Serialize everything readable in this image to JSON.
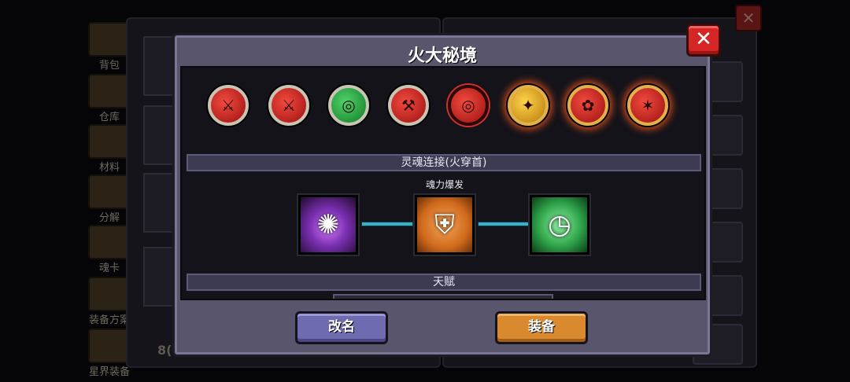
{
  "background": {
    "sidebar": [
      {
        "label": "背包",
        "icon": "backpack-icon"
      },
      {
        "label": "仓库",
        "icon": "chest-icon"
      },
      {
        "label": "材料",
        "icon": "materials-icon"
      },
      {
        "label": "分解",
        "icon": "decompose-icon"
      },
      {
        "label": "魂卡",
        "icon": "soul-card-icon"
      },
      {
        "label": "装备方案",
        "icon": "equipment-plan-icon"
      },
      {
        "label": "星界装备",
        "icon": "astral-equipment-icon"
      }
    ],
    "close_label": "✕",
    "bottom_value": "8("
  },
  "dialog": {
    "title": "火大秘境",
    "close_label": "✕",
    "equipment_icons": [
      {
        "name": "amulet-red-icon",
        "glyph": "⚔",
        "style": "red"
      },
      {
        "name": "sword-red-icon",
        "glyph": "⚔",
        "style": "red"
      },
      {
        "name": "ring-green-icon",
        "glyph": "◎",
        "style": "green"
      },
      {
        "name": "axe-red-icon",
        "glyph": "⚒",
        "style": "red"
      },
      {
        "name": "ring-red-icon",
        "glyph": "◎",
        "style": "red"
      },
      {
        "name": "gem-gold-fire-icon",
        "glyph": "✦",
        "style": "gold-fire"
      },
      {
        "name": "rune-red-fire-icon",
        "glyph": "✿",
        "style": "red-fire"
      },
      {
        "name": "staff-red-fire-icon",
        "glyph": "✶",
        "style": "red-fire"
      }
    ],
    "soul_link_header": "灵魂连接(火穿首)",
    "soul_link_skill": "魂力爆发",
    "soul_cards": [
      {
        "name": "soul-card-purple-flame-icon",
        "glyph": "✺",
        "style": "purple"
      },
      {
        "name": "soul-card-shield-bow-icon",
        "glyph": "⛨",
        "style": "orange"
      },
      {
        "name": "soul-card-clock-icon",
        "glyph": "◷",
        "style": "green"
      }
    ],
    "talent_header": "天赋",
    "rename_button": "改名",
    "equip_button": "装备"
  }
}
